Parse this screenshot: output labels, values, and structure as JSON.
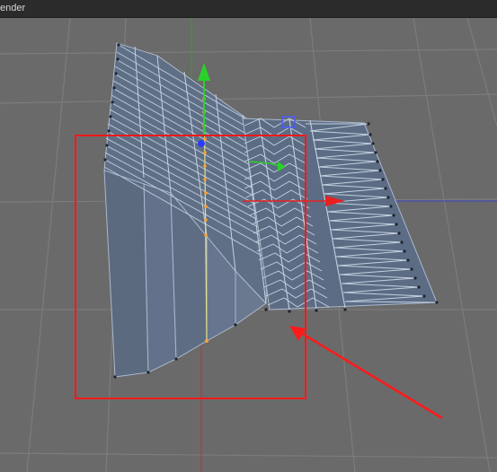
{
  "window": {
    "title_fragment": "ender"
  },
  "viewport": {
    "background_color": "#6a6a6a",
    "grid_color": "#7a7a7a",
    "mesh_face_color": "#5f6f86",
    "mesh_edge_color": "#a9b8cc",
    "mesh_vertex_color": "#1c2230",
    "axis_y_color": "#2bd12b",
    "axis_x_color": "#e82020",
    "axis_z_color": "#2a3cff",
    "selection_point_color": "#ffa030",
    "annotation_color": "#ff1a1a"
  }
}
